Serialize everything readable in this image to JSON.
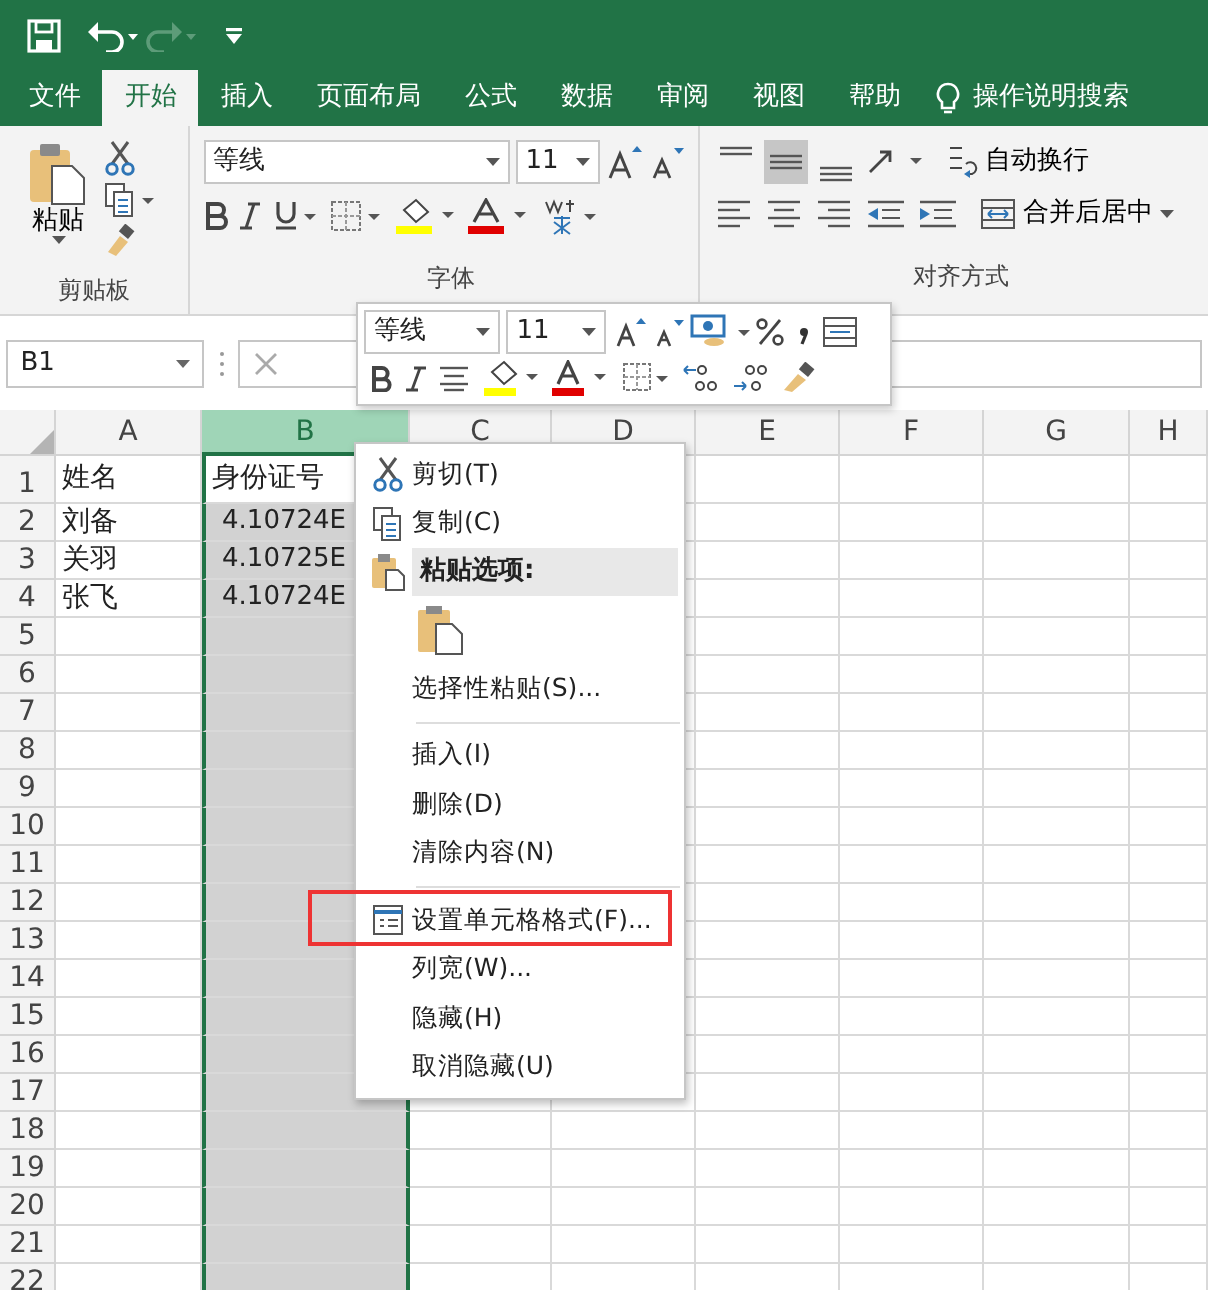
{
  "quick_access": {
    "redo_disabled": true
  },
  "tabs": [
    {
      "label": "文件",
      "selected": false
    },
    {
      "label": "开始",
      "selected": true
    },
    {
      "label": "插入",
      "selected": false
    },
    {
      "label": "页面布局",
      "selected": false
    },
    {
      "label": "公式",
      "selected": false
    },
    {
      "label": "数据",
      "selected": false
    },
    {
      "label": "审阅",
      "selected": false
    },
    {
      "label": "视图",
      "selected": false
    },
    {
      "label": "帮助",
      "selected": false
    }
  ],
  "tell_me": "操作说明搜索",
  "ribbon": {
    "clipboard": {
      "paste": "粘贴",
      "label": "剪贴板"
    },
    "font": {
      "font_name": "等线",
      "font_size": "11",
      "label": "字体"
    },
    "alignment": {
      "wrap_text": "自动换行",
      "merge_center": "合并后居中",
      "label": "对齐方式"
    }
  },
  "name_box": "B1",
  "mini_toolbar": {
    "font_name": "等线",
    "font_size": "11"
  },
  "columns": [
    {
      "label": "A",
      "selected": false
    },
    {
      "label": "B",
      "selected": true
    },
    {
      "label": "C",
      "selected": false
    },
    {
      "label": "D",
      "selected": false
    },
    {
      "label": "E",
      "selected": false
    },
    {
      "label": "F",
      "selected": false
    },
    {
      "label": "G",
      "selected": false
    },
    {
      "label": "H",
      "selected": false
    }
  ],
  "rows": [
    {
      "number": "1",
      "cells": [
        {
          "text": "姓名",
          "kind": "text",
          "active": false
        },
        {
          "text": "身份证号",
          "kind": "text",
          "active": true
        }
      ]
    },
    {
      "number": "2",
      "cells": [
        {
          "text": "刘备",
          "kind": "text",
          "active": false
        },
        {
          "text": "4.10724E",
          "kind": "number",
          "active": false
        }
      ]
    },
    {
      "number": "3",
      "cells": [
        {
          "text": "关羽",
          "kind": "text",
          "active": false
        },
        {
          "text": "4.10725E",
          "kind": "number",
          "active": false
        }
      ]
    },
    {
      "number": "4",
      "cells": [
        {
          "text": "张飞",
          "kind": "text",
          "active": false
        },
        {
          "text": "4.10724E",
          "kind": "number",
          "active": false
        }
      ]
    },
    {
      "number": "5"
    },
    {
      "number": "6"
    },
    {
      "number": "7"
    },
    {
      "number": "8"
    },
    {
      "number": "9"
    },
    {
      "number": "10"
    },
    {
      "number": "11"
    },
    {
      "number": "12"
    },
    {
      "number": "13"
    },
    {
      "number": "14"
    },
    {
      "number": "15"
    },
    {
      "number": "16"
    },
    {
      "number": "17"
    },
    {
      "number": "18"
    },
    {
      "number": "19"
    },
    {
      "number": "20"
    },
    {
      "number": "21"
    },
    {
      "number": "22"
    }
  ],
  "context_menu": [
    {
      "kind": "cut",
      "label": "剪切(T)",
      "annotated": false
    },
    {
      "kind": "copy",
      "label": "复制(C)",
      "annotated": false
    },
    {
      "kind": "paste_header",
      "label": "粘贴选项:"
    },
    {
      "kind": "paste_buttons"
    },
    {
      "kind": "command",
      "label": "选择性粘贴(S)...",
      "annotated": false
    },
    {
      "kind": "separator"
    },
    {
      "kind": "command",
      "label": "插入(I)",
      "annotated": false
    },
    {
      "kind": "command",
      "label": "删除(D)",
      "annotated": false
    },
    {
      "kind": "command",
      "label": "清除内容(N)",
      "annotated": false
    },
    {
      "kind": "separator"
    },
    {
      "kind": "format_cells",
      "label": "设置单元格格式(F)...",
      "annotated": true
    },
    {
      "kind": "command",
      "label": "列宽(W)...",
      "annotated": false
    },
    {
      "kind": "command",
      "label": "隐藏(H)",
      "annotated": false
    },
    {
      "kind": "command",
      "label": "取消隐藏(U)",
      "annotated": false
    }
  ]
}
